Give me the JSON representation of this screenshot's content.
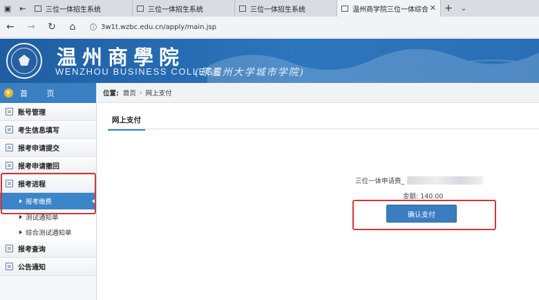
{
  "browser": {
    "tabs": [
      {
        "label": "三位一体招生系统",
        "active": false
      },
      {
        "label": "三位一体招生系统",
        "active": false
      },
      {
        "label": "三位一体招生系统",
        "active": false
      },
      {
        "label": "温州商学院三位一体综合",
        "active": true
      }
    ],
    "url": "3w1t.wzbc.edu.cn/apply/main.jsp"
  },
  "banner": {
    "name_cn": "温州商學院",
    "name_en": "WENZHOU BUSINESS COLLEGE",
    "subtitle": "(原温州大学城市学院)"
  },
  "sidebar": {
    "home_label": "首 页",
    "items": [
      {
        "label": "账号管理"
      },
      {
        "label": "考生信息填写"
      },
      {
        "label": "报考申请提交"
      },
      {
        "label": "报考申请撤回"
      },
      {
        "label": "报考进程"
      }
    ],
    "sub_items": [
      {
        "label": "报考缴费",
        "active": true
      },
      {
        "label": "测试通知单",
        "active": false
      },
      {
        "label": "综合测试通知单",
        "active": false
      }
    ],
    "items_after": [
      {
        "label": "报考查询"
      },
      {
        "label": "公告通知"
      }
    ]
  },
  "breadcrumb": {
    "prefix": "位置:",
    "home": "首页",
    "current": "网上支付"
  },
  "panel": {
    "tab_label": "网上支付",
    "fee_label": "三位一体申请费_",
    "amount": "金额: 140.00",
    "confirm_button": "确认支付"
  },
  "colors": {
    "banner_blue": "#2c76bd",
    "active_blue": "#3a86c8",
    "button_blue": "#3a7dc0",
    "highlight_red": "#d63434"
  }
}
